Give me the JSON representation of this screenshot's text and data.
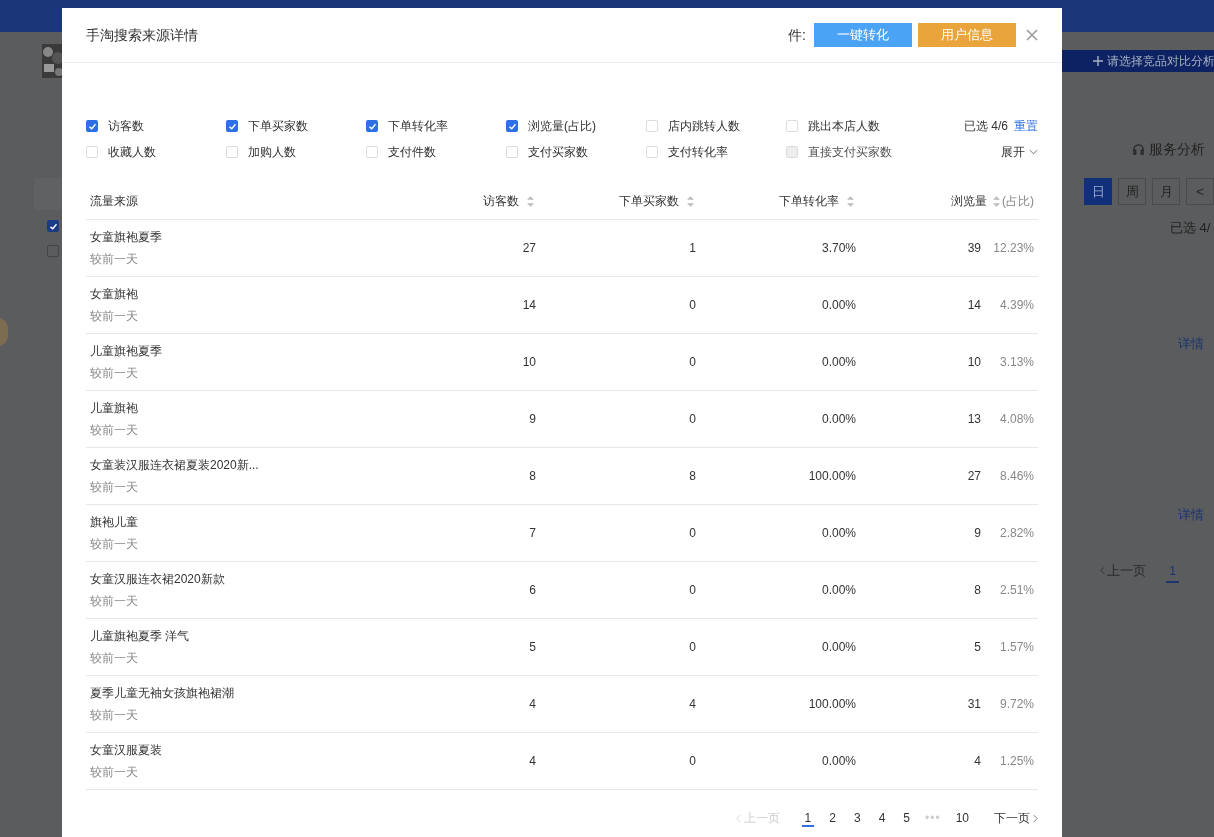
{
  "background_page": {
    "compare_button": "请选择竞品对比分析",
    "left_checkboxes": [
      {
        "checked": true
      },
      {
        "checked": false
      }
    ],
    "service_analysis": "服务分析",
    "period_buttons": [
      {
        "label": "日",
        "selected": true
      },
      {
        "label": "周",
        "selected": false
      },
      {
        "label": "月",
        "selected": false
      },
      {
        "label": "<",
        "selected": false
      }
    ],
    "selected_count": "已选 4/",
    "detail_links": [
      "详情",
      "详情"
    ],
    "pagination": {
      "prev": "上一页",
      "page": "1"
    }
  },
  "dialog": {
    "title": "手淘搜索来源详情",
    "field_label": "件:",
    "buttons": [
      {
        "label": "一键转化",
        "kind": "primary"
      },
      {
        "label": "用户信息",
        "kind": "warning"
      }
    ],
    "metrics": [
      {
        "label": "访客数",
        "checked": true,
        "disabled": false
      },
      {
        "label": "下单买家数",
        "checked": true,
        "disabled": false
      },
      {
        "label": "下单转化率",
        "checked": true,
        "disabled": false
      },
      {
        "label": "浏览量(占比)",
        "checked": true,
        "disabled": false
      },
      {
        "label": "店内跳转人数",
        "checked": false,
        "disabled": false
      },
      {
        "label": "跳出本店人数",
        "checked": false,
        "disabled": false
      },
      {
        "label": "收藏人数",
        "checked": false,
        "disabled": false
      },
      {
        "label": "加购人数",
        "checked": false,
        "disabled": false
      },
      {
        "label": "支付件数",
        "checked": false,
        "disabled": false
      },
      {
        "label": "支付买家数",
        "checked": false,
        "disabled": false
      },
      {
        "label": "支付转化率",
        "checked": false,
        "disabled": false
      },
      {
        "label": "直接支付买家数",
        "checked": false,
        "disabled": true
      }
    ],
    "selected_count": "已选 4/6",
    "reset": "重置",
    "expand": "展开",
    "table": {
      "columns": [
        "流量来源",
        "访客数",
        "下单买家数",
        "下单转化率",
        "浏览量",
        "(占比)"
      ],
      "rows": [
        {
          "source": "女童旗袍夏季",
          "compare": "较前一天",
          "visitors": "27",
          "buyers": "1",
          "conversion": "3.70%",
          "views": "39",
          "share": "12.23%"
        },
        {
          "source": "女童旗袍",
          "compare": "较前一天",
          "visitors": "14",
          "buyers": "0",
          "conversion": "0.00%",
          "views": "14",
          "share": "4.39%"
        },
        {
          "source": "儿童旗袍夏季",
          "compare": "较前一天",
          "visitors": "10",
          "buyers": "0",
          "conversion": "0.00%",
          "views": "10",
          "share": "3.13%"
        },
        {
          "source": "儿童旗袍",
          "compare": "较前一天",
          "visitors": "9",
          "buyers": "0",
          "conversion": "0.00%",
          "views": "13",
          "share": "4.08%"
        },
        {
          "source": "女童装汉服连衣裙夏装2020新...",
          "compare": "较前一天",
          "visitors": "8",
          "buyers": "8",
          "conversion": "100.00%",
          "views": "27",
          "share": "8.46%"
        },
        {
          "source": "旗袍儿童",
          "compare": "较前一天",
          "visitors": "7",
          "buyers": "0",
          "conversion": "0.00%",
          "views": "9",
          "share": "2.82%"
        },
        {
          "source": "女童汉服连衣裙2020新款",
          "compare": "较前一天",
          "visitors": "6",
          "buyers": "0",
          "conversion": "0.00%",
          "views": "8",
          "share": "2.51%"
        },
        {
          "source": "儿童旗袍夏季 洋气",
          "compare": "较前一天",
          "visitors": "5",
          "buyers": "0",
          "conversion": "0.00%",
          "views": "5",
          "share": "1.57%"
        },
        {
          "source": "夏季儿童无袖女孩旗袍裙潮",
          "compare": "较前一天",
          "visitors": "4",
          "buyers": "4",
          "conversion": "100.00%",
          "views": "31",
          "share": "9.72%"
        },
        {
          "source": "女童汉服夏装",
          "compare": "较前一天",
          "visitors": "4",
          "buyers": "0",
          "conversion": "0.00%",
          "views": "4",
          "share": "1.25%"
        }
      ]
    },
    "pagination": {
      "prev": "上一页",
      "pages": [
        {
          "label": "1",
          "selected": true
        },
        {
          "label": "2",
          "selected": false
        },
        {
          "label": "3",
          "selected": false
        },
        {
          "label": "4",
          "selected": false
        },
        {
          "label": "5",
          "selected": false
        },
        {
          "label": "10",
          "selected": false
        }
      ],
      "ellipsis": "•••",
      "next": "下一页"
    }
  }
}
